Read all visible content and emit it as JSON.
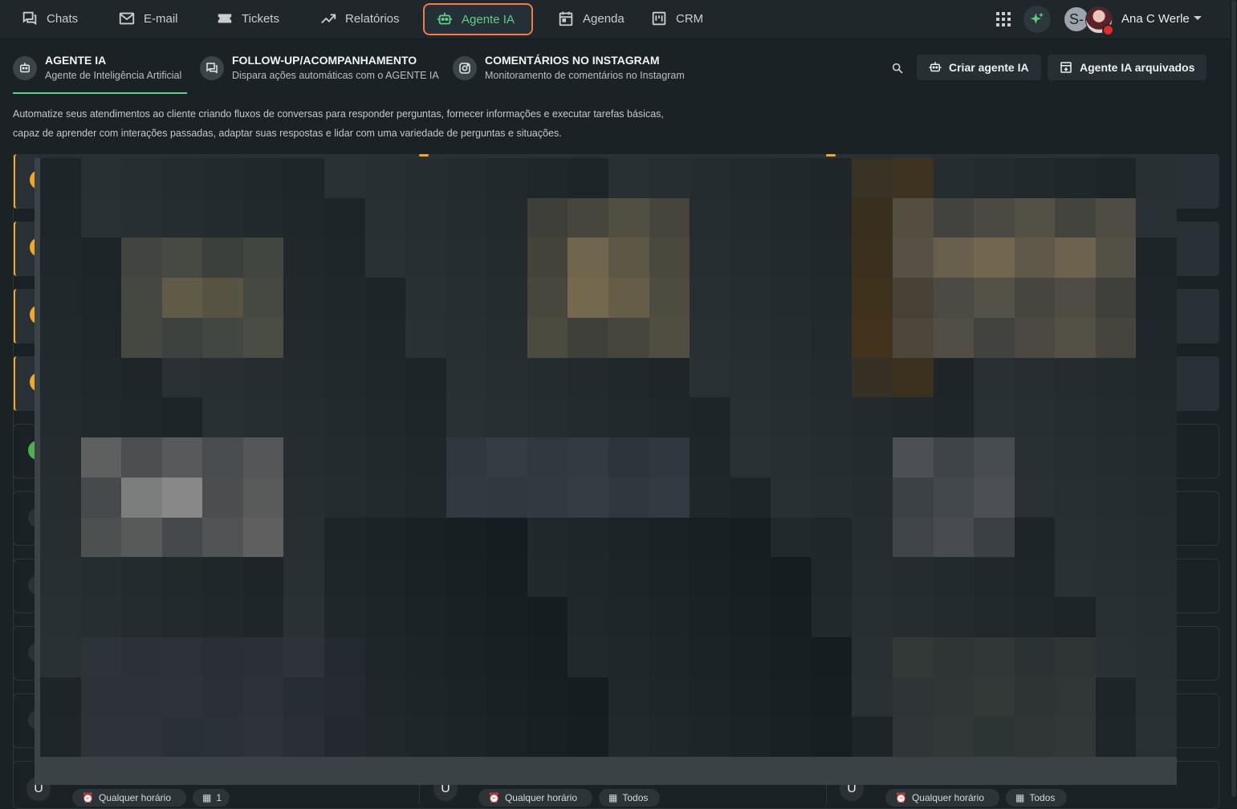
{
  "nav": {
    "items": [
      {
        "label": "Chats",
        "icon": "chat-icon"
      },
      {
        "label": "E-mail",
        "icon": "mail-icon"
      },
      {
        "label": "Tickets",
        "icon": "ticket-icon"
      },
      {
        "label": "Relatórios",
        "icon": "chart-icon"
      },
      {
        "label": "Agente IA",
        "icon": "robot-icon",
        "active": true
      },
      {
        "label": "Agenda",
        "icon": "calendar-icon"
      },
      {
        "label": "CRM",
        "icon": "kanban-icon"
      }
    ],
    "accent_active": "#5fcf80",
    "active_border": "#f07a4a"
  },
  "user": {
    "initial": "S-",
    "name": "Ana C Werle",
    "status_color": "#e22b2b"
  },
  "subtabs": [
    {
      "title": "AGENTE IA",
      "subtitle": "Agente de Inteligência Artificial",
      "icon": "robot-icon",
      "active": true
    },
    {
      "title": "FOLLOW-UP/ACOMPANHAMENTO",
      "subtitle": "Dispara ações automáticas com o AGENTE IA",
      "icon": "chat-icon"
    },
    {
      "title": "COMENTÁRIOS NO INSTAGRAM",
      "subtitle": "Monitoramento de comentários no Instagram",
      "icon": "instagram-icon"
    }
  ],
  "actions": {
    "create_label": "Criar agente IA",
    "archived_label": "Agente IA arquivados"
  },
  "description": {
    "line1": "Automatize seus atendimentos ao cliente criando fluxos de conversas para responder perguntas, fornecer informações e executar tarefas básicas,",
    "line2": "capaz de aprender com interações passadas, adaptar suas respostas e lidar com uma variedade de perguntas e situações."
  },
  "cards": [
    {
      "letter": "U",
      "schedule": "Qualquer horário",
      "scope": "1"
    },
    {
      "letter": "U",
      "schedule": "Qualquer horário",
      "scope": "Todos"
    },
    {
      "letter": "U",
      "schedule": "Qualquer horário",
      "scope": "Todos"
    }
  ],
  "colors": {
    "flag": "#f5a623",
    "status_green": "#4caf50",
    "status_orange": "#f5a623"
  }
}
